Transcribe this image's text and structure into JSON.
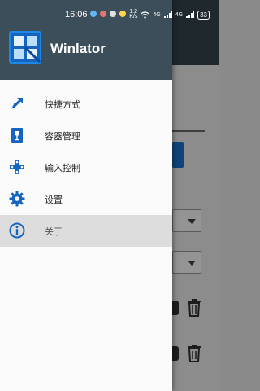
{
  "status_bar": {
    "time": "16:06",
    "network_speed": "1.2\nK/s",
    "signal_left": "4G",
    "signal_right": "4G",
    "battery": "33"
  },
  "drawer": {
    "app_title": "Winlator",
    "menu_items": [
      {
        "label": "快捷方式",
        "icon": "shortcut-arrow-icon"
      },
      {
        "label": "容器管理",
        "icon": "container-wine-glass-icon"
      },
      {
        "label": "输入控制",
        "icon": "dpad-gamepad-icon"
      },
      {
        "label": "设置",
        "icon": "gear-icon"
      },
      {
        "label": "关于",
        "icon": "info-icon",
        "selected": true
      }
    ]
  },
  "colors": {
    "header": "#3c4e5a",
    "accent_blue": "#1565c0",
    "selected_row": "#dddddd"
  }
}
